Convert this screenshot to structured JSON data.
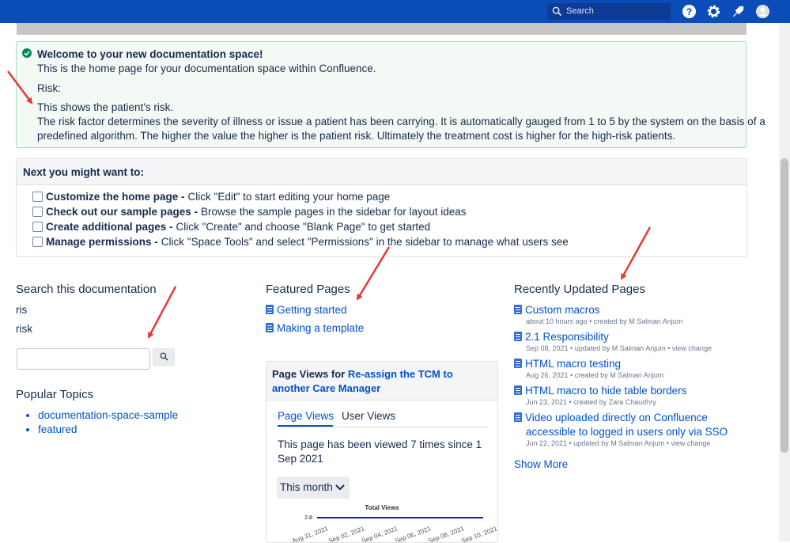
{
  "header": {
    "search_placeholder": "Search"
  },
  "welcome": {
    "title": "Welcome to your new documentation space!",
    "line1": "This is the home page for your documentation space within Confluence.",
    "risk_label": "Risk:",
    "risk_desc": "This shows the patient's risk.",
    "risk_detail_1": "The risk factor determines the severity of illness or issue a patient has been carrying. It is automatically gauged from 1 to 5 by the system on the basis of a",
    "risk_detail_2": "predefined algorithm. The higher the value the higher is the patient risk. Ultimately the treatment cost is higher for the high-risk patients."
  },
  "next_steps": {
    "title": "Next you might want to:",
    "items": [
      {
        "bold": "Customize the home page -",
        "text": "Click \"Edit\" to start editing your home page",
        "checked": false
      },
      {
        "bold": "Check out our sample pages -",
        "text": "Browse the sample pages in the sidebar for layout ideas",
        "checked": false
      },
      {
        "bold": "Create additional pages -",
        "text": "Click \"Create\" and choose \"Blank Page\" to get started",
        "checked": false
      },
      {
        "bold": "Manage permissions -",
        "text": "Click \"Space Tools\" and select \"Permissions\" in the sidebar to manage what users see",
        "checked": false
      }
    ]
  },
  "search_doc": {
    "title": "Search this documentation",
    "terms": [
      "ris",
      "risk"
    ]
  },
  "popular": {
    "title": "Popular Topics",
    "items": [
      "documentation-space-sample",
      "featured"
    ]
  },
  "featured": {
    "title": "Featured Pages",
    "items": [
      "Getting started",
      "Making a template"
    ]
  },
  "page_views": {
    "prefix": "Page Views for",
    "page_title": "Re-assign the TCM to another Care Manager",
    "tabs": [
      "Page Views",
      "User Views"
    ],
    "viewed_text": "This page has been viewed 7 times since 1 Sep 2021",
    "period": "This month"
  },
  "chart_data": {
    "type": "line",
    "title": "Total Views",
    "x": [
      "Aug 31, 2021",
      "Sep 02, 2021",
      "Sep 04, 2021",
      "Sep 06, 2021",
      "Sep 08, 2021",
      "Sep 10, 2021"
    ],
    "series": [
      {
        "values": [
          2,
          2,
          2,
          2,
          2,
          2
        ]
      }
    ],
    "y_tick_labels": [
      "2.8",
      "2.0"
    ],
    "color": "#1c1ca8"
  },
  "recent": {
    "title": "Recently Updated Pages",
    "items": [
      {
        "title": "Custom macros",
        "meta": "about 10 hours ago • created by M Salman Anjum"
      },
      {
        "title": "2.1 Responsibility",
        "meta": "Sep 08, 2021 • updated by M Salman Anjum • view change"
      },
      {
        "title": "HTML macro testing",
        "meta": "Aug 26, 2021 • created by M Salman Anjum"
      },
      {
        "title": "HTML macro to hide table borders",
        "meta": "Jun 23, 2021 • created by Zara Chaudhry"
      },
      {
        "title_line1": "Video uploaded directly on Confluence",
        "title_line2": "accessible to logged in users only via SSO",
        "meta": "Jun 22, 2021 • updated by M Salman Anjum • view change"
      }
    ],
    "show_more": "Show More"
  },
  "colors": {
    "header": "#0a4cb8",
    "link": "#0052cc",
    "annotation_arrow": "#e53935"
  }
}
